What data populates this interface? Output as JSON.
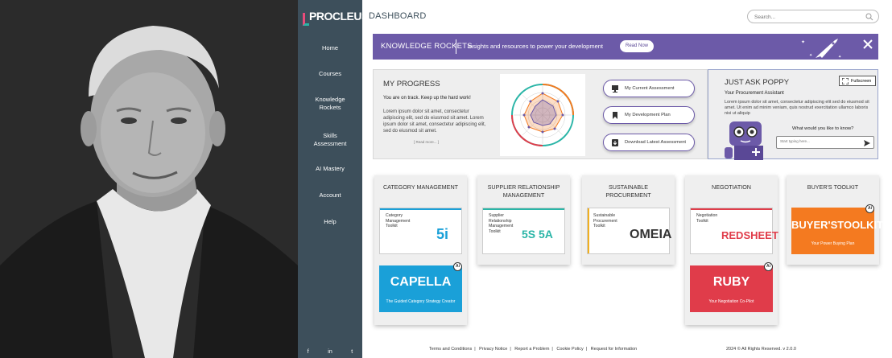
{
  "app": {
    "logo_text": "PROCLEUS",
    "page_title": "DASHBOARD"
  },
  "search": {
    "placeholder": "Search..."
  },
  "sidebar": {
    "items": [
      {
        "label": "Home"
      },
      {
        "label": "Courses"
      },
      {
        "label": "Knowledge Rockets"
      },
      {
        "label": "Skills Assessment"
      },
      {
        "label": "AI Mastery"
      },
      {
        "label": "Account"
      },
      {
        "label": "Help"
      }
    ],
    "social": [
      "f",
      "in",
      "t"
    ]
  },
  "banner": {
    "title": "KNOWLEDGE ROCKETS",
    "description": "Insights and resources to power your development",
    "button": "Read Now",
    "color": "#6c5aa8"
  },
  "progress": {
    "title": "MY PROGRESS",
    "subtitle": "You are on track. Keep up the hard work!",
    "lorem": "Lorem ipsum dolor sit amet, consectetur adipiscing elit, sed do eiusmod sit amet. Lorem ipsum dolor sit amet, consectetur adipiscing elit, sed do eiusmod sit amet.",
    "read_more": "[ Read more... ]",
    "buttons": [
      {
        "label": "My Current Assessment",
        "icon": "monitor-icon"
      },
      {
        "label": "My Development Plan",
        "icon": "bookmark-icon"
      },
      {
        "label": "Download Latest Assessment",
        "icon": "download-icon"
      }
    ]
  },
  "poppy": {
    "title": "JUST ASK POPPY",
    "subtitle": "Your Procurement Assistant",
    "lorem": "Lorem ipsum dolor sit amet, consectetur adipiscing elit sed do eiusmod sit amet. Ut enim ad minim veniam, quis nostrud exercitation ullamco laboris nisi ut aliquip",
    "fullscreen": "Fullscreen",
    "question": "What would you like to know?",
    "input_placeholder": "Start typing here..."
  },
  "cards": [
    {
      "title": "CATEGORY MANAGEMENT",
      "toolkits": [
        {
          "label": "Category Management Toolkit",
          "mark": "5i",
          "color": "#1aa0d8"
        },
        {
          "label": "CAPELLA",
          "tagline": "The Guided Category Strategy Creator",
          "color": "#1aa0d8",
          "ai": "Ai"
        }
      ]
    },
    {
      "title": "SUPPLIER RELATIONSHIP MANAGEMENT",
      "toolkits": [
        {
          "label": "Supplier Relationship Management Toolkit",
          "mark": "5S 5A",
          "color": "#2ab5a7"
        }
      ]
    },
    {
      "title": "SUSTAINABLE PROCUREMENT",
      "toolkits": [
        {
          "label": "Sustainable Procurement Toolkit",
          "mark": "OMEIA",
          "color": "#f2b01e"
        }
      ]
    },
    {
      "title": "NEGOTIATION",
      "toolkits": [
        {
          "label": "Negotiation Toolkit",
          "mark": "REDSHEET",
          "color": "#e03c4a"
        },
        {
          "label": "RUBY",
          "tagline": "Your Negotiation Co-Pilot",
          "color": "#e03c4a",
          "ai": "Ai"
        }
      ]
    },
    {
      "title": "BUYER'S TOOLKIT",
      "toolkits": [
        {
          "label": "BUYER'STOOLKIT",
          "tagline": "Your Power Buying Plan",
          "color": "#f47a20",
          "ai": "Ai"
        }
      ]
    }
  ],
  "footer": {
    "links": [
      "Terms and Conditions",
      "Privacy Notice",
      "Report a Problem",
      "Cookie Policy",
      "Request for Information"
    ],
    "copyright": "2024 © All Rights Reserved. v 2.0.0"
  }
}
